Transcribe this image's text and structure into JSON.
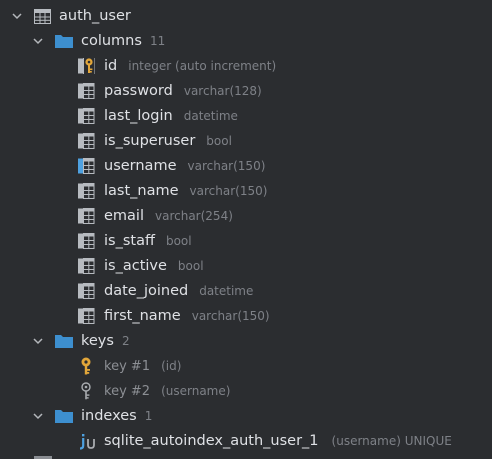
{
  "tree": {
    "table": {
      "name": "auth_user"
    },
    "columns": {
      "label": "columns",
      "count": "11",
      "items": [
        {
          "name": "id",
          "type": "integer (auto increment)",
          "icon": "primary-key-column-icon"
        },
        {
          "name": "password",
          "type": "varchar(128)",
          "icon": "column-icon"
        },
        {
          "name": "last_login",
          "type": "datetime",
          "icon": "column-icon"
        },
        {
          "name": "is_superuser",
          "type": "bool",
          "icon": "column-icon"
        },
        {
          "name": "username",
          "type": "varchar(150)",
          "icon": "indexed-column-icon"
        },
        {
          "name": "last_name",
          "type": "varchar(150)",
          "icon": "column-icon"
        },
        {
          "name": "email",
          "type": "varchar(254)",
          "icon": "column-icon"
        },
        {
          "name": "is_staff",
          "type": "bool",
          "icon": "column-icon"
        },
        {
          "name": "is_active",
          "type": "bool",
          "icon": "column-icon"
        },
        {
          "name": "date_joined",
          "type": "datetime",
          "icon": "column-icon"
        },
        {
          "name": "first_name",
          "type": "varchar(150)",
          "icon": "column-icon"
        }
      ]
    },
    "keys": {
      "label": "keys",
      "count": "2",
      "items": [
        {
          "name": "key #1",
          "detail": "(id)",
          "icon": "primary-key-icon"
        },
        {
          "name": "key #2",
          "detail": "(username)",
          "icon": "unique-key-icon"
        }
      ]
    },
    "indexes": {
      "label": "indexes",
      "count": "1",
      "items": [
        {
          "name": "sqlite_autoindex_auth_user_1",
          "detail": "(username) UNIQUE",
          "icon": "unique-index-icon"
        }
      ]
    }
  },
  "colors": {
    "background": "#2b2d30",
    "folder": "#3d8fcf",
    "key_gold": "#e3a73a",
    "key_gray": "#a9acb0",
    "table_icon": "#b7bbc0",
    "index_blue": "#4ea1e0"
  }
}
